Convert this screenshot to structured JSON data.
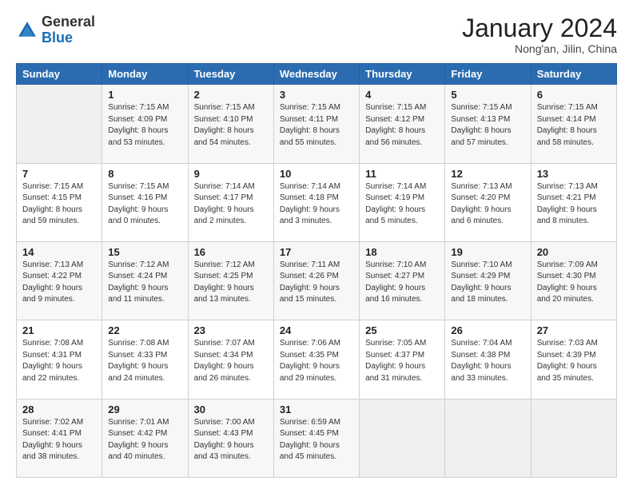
{
  "header": {
    "logo_general": "General",
    "logo_blue": "Blue",
    "month_title": "January 2024",
    "location": "Nong'an, Jilin, China"
  },
  "days_of_week": [
    "Sunday",
    "Monday",
    "Tuesday",
    "Wednesday",
    "Thursday",
    "Friday",
    "Saturday"
  ],
  "weeks": [
    [
      {
        "day": "",
        "sunrise": "",
        "sunset": "",
        "daylight": ""
      },
      {
        "day": "1",
        "sunrise": "Sunrise: 7:15 AM",
        "sunset": "Sunset: 4:09 PM",
        "daylight": "Daylight: 8 hours and 53 minutes."
      },
      {
        "day": "2",
        "sunrise": "Sunrise: 7:15 AM",
        "sunset": "Sunset: 4:10 PM",
        "daylight": "Daylight: 8 hours and 54 minutes."
      },
      {
        "day": "3",
        "sunrise": "Sunrise: 7:15 AM",
        "sunset": "Sunset: 4:11 PM",
        "daylight": "Daylight: 8 hours and 55 minutes."
      },
      {
        "day": "4",
        "sunrise": "Sunrise: 7:15 AM",
        "sunset": "Sunset: 4:12 PM",
        "daylight": "Daylight: 8 hours and 56 minutes."
      },
      {
        "day": "5",
        "sunrise": "Sunrise: 7:15 AM",
        "sunset": "Sunset: 4:13 PM",
        "daylight": "Daylight: 8 hours and 57 minutes."
      },
      {
        "day": "6",
        "sunrise": "Sunrise: 7:15 AM",
        "sunset": "Sunset: 4:14 PM",
        "daylight": "Daylight: 8 hours and 58 minutes."
      }
    ],
    [
      {
        "day": "7",
        "sunrise": "Sunrise: 7:15 AM",
        "sunset": "Sunset: 4:15 PM",
        "daylight": "Daylight: 8 hours and 59 minutes."
      },
      {
        "day": "8",
        "sunrise": "Sunrise: 7:15 AM",
        "sunset": "Sunset: 4:16 PM",
        "daylight": "Daylight: 9 hours and 0 minutes."
      },
      {
        "day": "9",
        "sunrise": "Sunrise: 7:14 AM",
        "sunset": "Sunset: 4:17 PM",
        "daylight": "Daylight: 9 hours and 2 minutes."
      },
      {
        "day": "10",
        "sunrise": "Sunrise: 7:14 AM",
        "sunset": "Sunset: 4:18 PM",
        "daylight": "Daylight: 9 hours and 3 minutes."
      },
      {
        "day": "11",
        "sunrise": "Sunrise: 7:14 AM",
        "sunset": "Sunset: 4:19 PM",
        "daylight": "Daylight: 9 hours and 5 minutes."
      },
      {
        "day": "12",
        "sunrise": "Sunrise: 7:13 AM",
        "sunset": "Sunset: 4:20 PM",
        "daylight": "Daylight: 9 hours and 6 minutes."
      },
      {
        "day": "13",
        "sunrise": "Sunrise: 7:13 AM",
        "sunset": "Sunset: 4:21 PM",
        "daylight": "Daylight: 9 hours and 8 minutes."
      }
    ],
    [
      {
        "day": "14",
        "sunrise": "Sunrise: 7:13 AM",
        "sunset": "Sunset: 4:22 PM",
        "daylight": "Daylight: 9 hours and 9 minutes."
      },
      {
        "day": "15",
        "sunrise": "Sunrise: 7:12 AM",
        "sunset": "Sunset: 4:24 PM",
        "daylight": "Daylight: 9 hours and 11 minutes."
      },
      {
        "day": "16",
        "sunrise": "Sunrise: 7:12 AM",
        "sunset": "Sunset: 4:25 PM",
        "daylight": "Daylight: 9 hours and 13 minutes."
      },
      {
        "day": "17",
        "sunrise": "Sunrise: 7:11 AM",
        "sunset": "Sunset: 4:26 PM",
        "daylight": "Daylight: 9 hours and 15 minutes."
      },
      {
        "day": "18",
        "sunrise": "Sunrise: 7:10 AM",
        "sunset": "Sunset: 4:27 PM",
        "daylight": "Daylight: 9 hours and 16 minutes."
      },
      {
        "day": "19",
        "sunrise": "Sunrise: 7:10 AM",
        "sunset": "Sunset: 4:29 PM",
        "daylight": "Daylight: 9 hours and 18 minutes."
      },
      {
        "day": "20",
        "sunrise": "Sunrise: 7:09 AM",
        "sunset": "Sunset: 4:30 PM",
        "daylight": "Daylight: 9 hours and 20 minutes."
      }
    ],
    [
      {
        "day": "21",
        "sunrise": "Sunrise: 7:08 AM",
        "sunset": "Sunset: 4:31 PM",
        "daylight": "Daylight: 9 hours and 22 minutes."
      },
      {
        "day": "22",
        "sunrise": "Sunrise: 7:08 AM",
        "sunset": "Sunset: 4:33 PM",
        "daylight": "Daylight: 9 hours and 24 minutes."
      },
      {
        "day": "23",
        "sunrise": "Sunrise: 7:07 AM",
        "sunset": "Sunset: 4:34 PM",
        "daylight": "Daylight: 9 hours and 26 minutes."
      },
      {
        "day": "24",
        "sunrise": "Sunrise: 7:06 AM",
        "sunset": "Sunset: 4:35 PM",
        "daylight": "Daylight: 9 hours and 29 minutes."
      },
      {
        "day": "25",
        "sunrise": "Sunrise: 7:05 AM",
        "sunset": "Sunset: 4:37 PM",
        "daylight": "Daylight: 9 hours and 31 minutes."
      },
      {
        "day": "26",
        "sunrise": "Sunrise: 7:04 AM",
        "sunset": "Sunset: 4:38 PM",
        "daylight": "Daylight: 9 hours and 33 minutes."
      },
      {
        "day": "27",
        "sunrise": "Sunrise: 7:03 AM",
        "sunset": "Sunset: 4:39 PM",
        "daylight": "Daylight: 9 hours and 35 minutes."
      }
    ],
    [
      {
        "day": "28",
        "sunrise": "Sunrise: 7:02 AM",
        "sunset": "Sunset: 4:41 PM",
        "daylight": "Daylight: 9 hours and 38 minutes."
      },
      {
        "day": "29",
        "sunrise": "Sunrise: 7:01 AM",
        "sunset": "Sunset: 4:42 PM",
        "daylight": "Daylight: 9 hours and 40 minutes."
      },
      {
        "day": "30",
        "sunrise": "Sunrise: 7:00 AM",
        "sunset": "Sunset: 4:43 PM",
        "daylight": "Daylight: 9 hours and 43 minutes."
      },
      {
        "day": "31",
        "sunrise": "Sunrise: 6:59 AM",
        "sunset": "Sunset: 4:45 PM",
        "daylight": "Daylight: 9 hours and 45 minutes."
      },
      {
        "day": "",
        "sunrise": "",
        "sunset": "",
        "daylight": ""
      },
      {
        "day": "",
        "sunrise": "",
        "sunset": "",
        "daylight": ""
      },
      {
        "day": "",
        "sunrise": "",
        "sunset": "",
        "daylight": ""
      }
    ]
  ]
}
